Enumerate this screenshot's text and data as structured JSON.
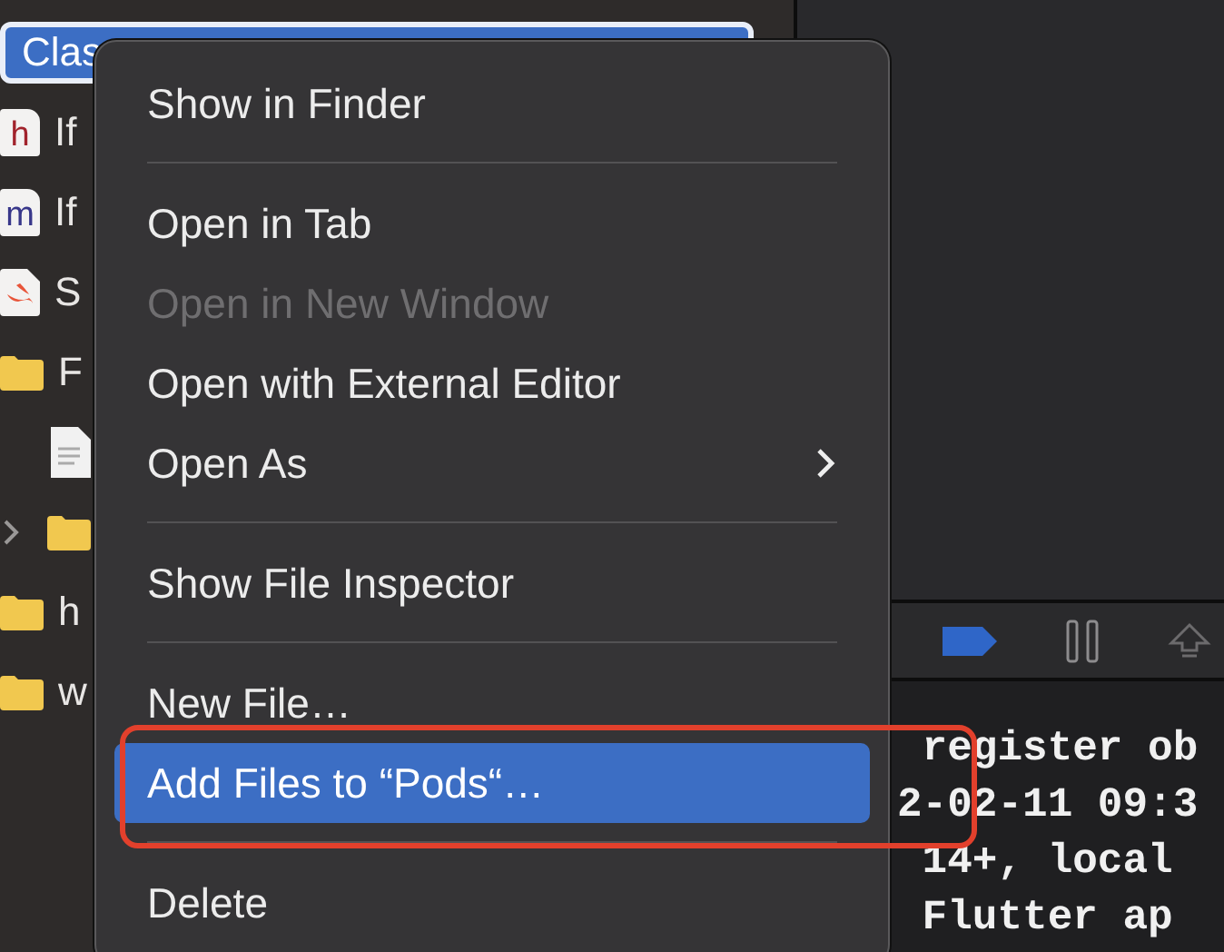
{
  "navigator": {
    "items": [
      {
        "kind": "group",
        "label": "Clas",
        "selected": true
      },
      {
        "kind": "header-file",
        "badge": "h",
        "label": "If",
        "selected": false
      },
      {
        "kind": "source-file",
        "badge": "m",
        "label": "If",
        "selected": false
      },
      {
        "kind": "swift-file",
        "label": "S",
        "selected": false
      },
      {
        "kind": "folder",
        "label": "F",
        "selected": false
      },
      {
        "kind": "doc",
        "selected": false
      },
      {
        "kind": "folder",
        "expandable": true,
        "selected": false
      },
      {
        "kind": "folder",
        "label": "h",
        "selected": false
      },
      {
        "kind": "folder",
        "label": "w",
        "selected": false
      }
    ]
  },
  "context_menu": {
    "items": [
      {
        "kind": "item",
        "label": "Show in Finder",
        "disabled": false,
        "selected": false
      },
      {
        "kind": "separator"
      },
      {
        "kind": "item",
        "label": "Open in Tab",
        "disabled": false,
        "selected": false
      },
      {
        "kind": "item",
        "label": "Open in New Window",
        "disabled": true,
        "selected": false
      },
      {
        "kind": "item",
        "label": "Open with External Editor",
        "disabled": false,
        "selected": false
      },
      {
        "kind": "item",
        "label": "Open As",
        "disabled": false,
        "selected": false,
        "submenu": true
      },
      {
        "kind": "separator"
      },
      {
        "kind": "item",
        "label": "Show File Inspector",
        "disabled": false,
        "selected": false
      },
      {
        "kind": "separator"
      },
      {
        "kind": "item",
        "label": "New File…",
        "disabled": false,
        "selected": false
      },
      {
        "kind": "item",
        "label": "Add Files to “Pods“…",
        "disabled": false,
        "selected": true
      },
      {
        "kind": "separator"
      },
      {
        "kind": "item",
        "label": "Delete",
        "disabled": false,
        "selected": false
      }
    ]
  },
  "console": {
    "lines": [
      " register ob",
      "2-02-11 09:3",
      " 14+, local",
      " Flutter ap"
    ]
  }
}
